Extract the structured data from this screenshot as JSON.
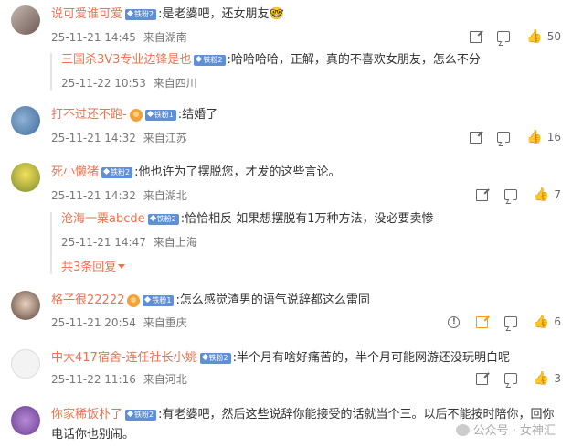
{
  "comments": [
    {
      "user": "说可爱谁可爱",
      "badge": "铁粉2",
      "text": ":是老婆吧，还女朋友",
      "emoji": "🤓",
      "time": "25-11-21 14:45",
      "location": "来自湖南",
      "likes": "50",
      "replies": [
        {
          "user": "三国杀3V3专业边锋是也",
          "badge": "铁粉2",
          "text": ":哈哈哈哈，正解，真的不喜欢女朋友，怎么不分",
          "time": "25-11-22 10:53",
          "location": "来自四川"
        }
      ]
    },
    {
      "user": "打不过还不跑-",
      "badge": "铁粉1",
      "text": ":结婚了",
      "time": "25-11-21 14:32",
      "location": "来自江苏",
      "likes": "16"
    },
    {
      "user": "死小懒猪",
      "badge": "铁粉2",
      "text": ":他也许为了摆脱您，才发的这些言论。",
      "time": "25-11-21 14:32",
      "location": "来自湖北",
      "likes": "7",
      "replies": [
        {
          "user": "沧海一粟abcde",
          "badge": "铁粉2",
          "text": ":恰恰相反 如果想摆脱有1万种方法，没必要卖惨",
          "time": "25-11-21 14:47",
          "location": "来自上海"
        }
      ],
      "more_replies": "共3条回复"
    },
    {
      "user": "格子很22222",
      "badge": "铁粉1",
      "text": ":怎么感觉渣男的语气说辞都这么雷同",
      "time": "25-11-21 20:54",
      "location": "来自重庆",
      "likes": "6"
    },
    {
      "user": "中大417宿舍-连任社长小姚",
      "badge": "铁粉2",
      "text": ":半个月有啥好痛苦的，半个月可能网游还没玩明白呢",
      "time": "25-11-22 11:16",
      "location": "来自河北",
      "likes": "3"
    },
    {
      "user": "你家稀饭朴了",
      "badge": "铁粉2",
      "text": ":有老婆吧，然后这些说辞你能接受的话就当个三。以后不能按时陪你，回你",
      "text2": "电话你也别闹。"
    }
  ],
  "watermark": "公众号 · 女神汇",
  "icons": {
    "share": "share-icon",
    "reply": "comment-icon",
    "like": "thumb-up-icon",
    "report": "report-icon"
  },
  "colors": {
    "username": "#eb7350",
    "badge": "#5e8fd8",
    "share_highlight": "#f39c12"
  }
}
